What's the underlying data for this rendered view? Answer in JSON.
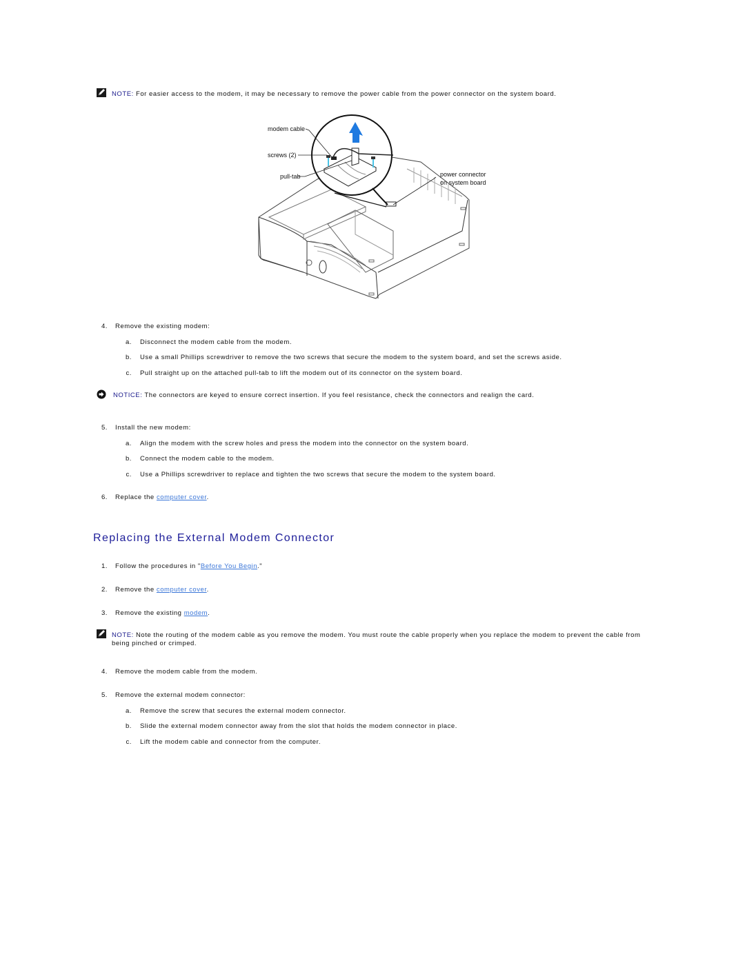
{
  "note1": {
    "label": "NOTE:",
    "text": " For easier access to the modem, it may be necessary to remove the power cable from the power connector on the system board."
  },
  "figure": {
    "callouts": {
      "modem_cable": "modem cable",
      "screws": "screws (2)",
      "pull_tab": "pull-tab",
      "power_connector_1": "power connector",
      "power_connector_2": "on system board"
    },
    "colors": {
      "arrow": "#1f7ae0",
      "screw_accent": "#49c3e6",
      "line": "#222222"
    }
  },
  "step4": {
    "num": "4.",
    "text": "Remove the existing modem:",
    "substeps": [
      {
        "letter": "a.",
        "text": "Disconnect the modem cable from the modem."
      },
      {
        "letter": "b.",
        "text": "Use a small Phillips screwdriver to remove the two screws that secure the modem to the system board, and set the screws aside."
      },
      {
        "letter": "c.",
        "text": "Pull straight up on the attached pull-tab to lift the modem out of its connector on the system board."
      }
    ]
  },
  "notice": {
    "label": "NOTICE:",
    "text": " The connectors are keyed to ensure correct insertion. If you feel resistance, check the connectors and realign the card."
  },
  "step5": {
    "num": "5.",
    "text": "Install the new modem:",
    "substeps": [
      {
        "letter": "a.",
        "text": "Align the modem with the screw holes and press the modem into the connector on the system board."
      },
      {
        "letter": "b.",
        "text": "Connect the modem cable to the modem."
      },
      {
        "letter": "c.",
        "text": "Use a Phillips screwdriver to replace and tighten the two screws that secure the modem to the system board."
      }
    ]
  },
  "step6": {
    "num": "6.",
    "prefix": "Replace the ",
    "link": "computer cover",
    "suffix": "."
  },
  "section2": {
    "title": "Replacing the External Modem Connector",
    "steps": [
      {
        "num": "1.",
        "prefix": "Follow the procedures in \"",
        "link": "Before You Begin",
        "suffix": ".\""
      },
      {
        "num": "2.",
        "prefix": "Remove the ",
        "link": "computer cover",
        "suffix": "."
      },
      {
        "num": "3.",
        "prefix": "Remove the existing ",
        "link": "modem",
        "suffix": "."
      }
    ],
    "note": {
      "label": "NOTE:",
      "text": " Note the routing of the modem cable as you remove the modem. You must route the cable properly when you replace the modem to prevent the cable from being pinched or crimped."
    },
    "step4": {
      "num": "4.",
      "text": "Remove the modem cable from the modem."
    },
    "step5": {
      "num": "5.",
      "text": "Remove the external modem connector:",
      "substeps": [
        {
          "letter": "a.",
          "text": "Remove the screw that secures the external modem connector."
        },
        {
          "letter": "b.",
          "text": "Slide the external modem connector away from the slot that holds the modem connector in place."
        },
        {
          "letter": "c.",
          "text": "Lift the modem cable and connector from the computer."
        }
      ]
    }
  }
}
